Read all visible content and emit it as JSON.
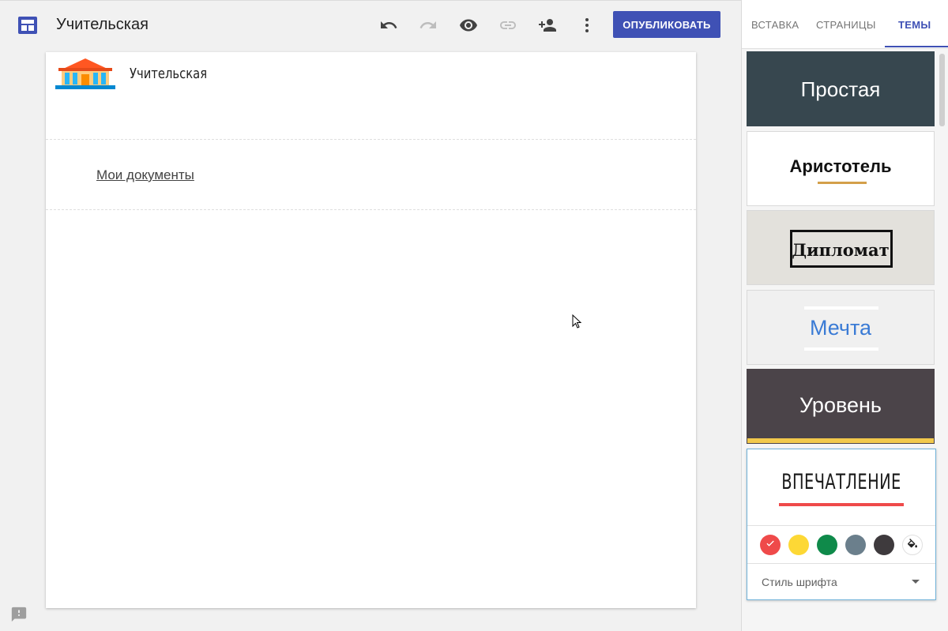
{
  "header": {
    "site_title": "Учительская",
    "publish_label": "ОПУБЛИКОВАТЬ",
    "icons": [
      "layout-icon",
      "undo-icon",
      "redo-icon",
      "preview-icon",
      "link-icon",
      "add-person-icon",
      "more-vert-icon"
    ]
  },
  "page": {
    "site_name": "Учительская",
    "nav_link": "Мои документы"
  },
  "panel": {
    "tabs": [
      {
        "label": "ВСТАВКА",
        "active": false
      },
      {
        "label": "СТРАНИЦЫ",
        "active": false
      },
      {
        "label": "ТЕМЫ",
        "active": true
      }
    ],
    "themes": [
      {
        "name": "Простая"
      },
      {
        "name": "Аристотель"
      },
      {
        "name": "Дипломат"
      },
      {
        "name": "Мечта"
      },
      {
        "name": "Уровень"
      },
      {
        "name": "ВПЕЧАТЛЕНИЕ",
        "selected": true
      }
    ],
    "color_swatches": [
      "#ef4a4a",
      "#fdd835",
      "#0f8a4a",
      "#6b7f8c",
      "#3e3a3d"
    ],
    "selected_swatch_index": 0,
    "font_style_label": "Стиль шрифта"
  },
  "colors": {
    "accent": "#3f51b5",
    "panel_bg": "#f5f5f5"
  }
}
